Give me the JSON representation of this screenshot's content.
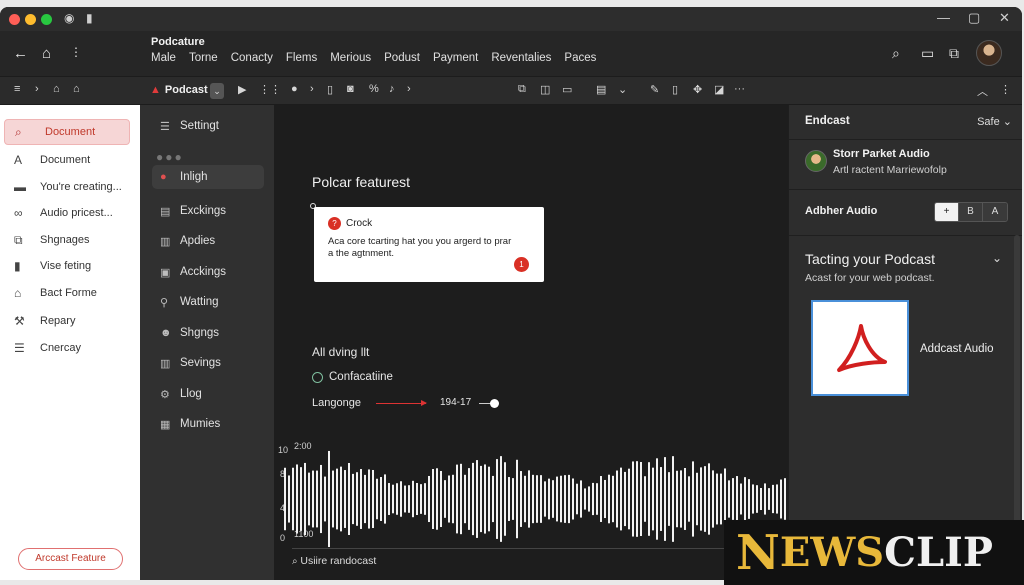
{
  "titlebar": {
    "colors": {
      "close": "#ff5f57",
      "minimize": "#febc2e",
      "maximize": "#28c840"
    }
  },
  "menubar": {
    "app_title": "Podcature",
    "menus": [
      "Male",
      "Torne",
      "Conacty",
      "Flems",
      "Merious",
      "Podust",
      "Payment",
      "Reventalies",
      "Paces"
    ]
  },
  "toolbar": {
    "doc_label": "Podcast"
  },
  "left_panel": {
    "items": [
      {
        "icon": "search-icon",
        "label": "Document",
        "active": true
      },
      {
        "icon": "text-icon",
        "label": "Document"
      },
      {
        "icon": "folder-icon",
        "label": "You're creating..."
      },
      {
        "icon": "link-icon",
        "label": "Audio pricest..."
      },
      {
        "icon": "copy-icon",
        "label": "Shgnages"
      },
      {
        "icon": "file-icon",
        "label": "Vise feting"
      },
      {
        "icon": "bank-icon",
        "label": "Bact Forme"
      },
      {
        "icon": "hammer-icon",
        "label": "Repary"
      },
      {
        "icon": "list-icon",
        "label": "Cnercay"
      }
    ],
    "button_label": "Arccast Feature"
  },
  "mid_panel": {
    "top_label": "Settingt",
    "items": [
      {
        "icon": "dot-icon",
        "label": "Inligh",
        "active": true
      },
      {
        "icon": "doc-icon",
        "label": "Exckings"
      },
      {
        "icon": "bars-icon",
        "label": "Apdies"
      },
      {
        "icon": "box-icon",
        "label": "Acckings"
      },
      {
        "icon": "pin-icon",
        "label": "Watting"
      },
      {
        "icon": "person-icon",
        "label": "Shgngs"
      },
      {
        "icon": "chart-icon",
        "label": "Sevings"
      },
      {
        "icon": "gear-icon",
        "label": "Llog"
      },
      {
        "icon": "grid-icon",
        "label": "Mumies"
      }
    ]
  },
  "main": {
    "section_title": "Polcar featurest",
    "popover": {
      "badge": "?",
      "title": "Crock",
      "body": "Aca core tcarting hat you you argerd to prar a the agtnment.",
      "count": "1"
    },
    "subheading": "All dving llt",
    "radio_label": "Confacatiine",
    "lang_label": "Langonge",
    "lang_value": "194-17",
    "wave_labels": {
      "top": "10",
      "top_val": "2:00",
      "mid": "8",
      "low": "4",
      "bot": "0",
      "bot_val": "1100"
    },
    "search_placeholder": "Usiire randocast"
  },
  "right_panel": {
    "title": "Endcast",
    "status": "Safe",
    "user_name": "Storr Parket Audio",
    "user_sub": "Artl ractent Marriewofolp",
    "audio_title": "Adbher Audio",
    "segments": [
      "+",
      "B",
      "A"
    ],
    "tp_title": "Tacting your Podcast",
    "tp_sub": "Acast for your web podcast.",
    "card_label": "Addcast Audio"
  },
  "watermark": {
    "text_big": "N",
    "text_mid": "EWS",
    "text_clip": "CLIP"
  },
  "colors": {
    "accent_red": "#d93025",
    "card_border": "#4a90d9",
    "watermark_gold": "#e8b83a"
  }
}
